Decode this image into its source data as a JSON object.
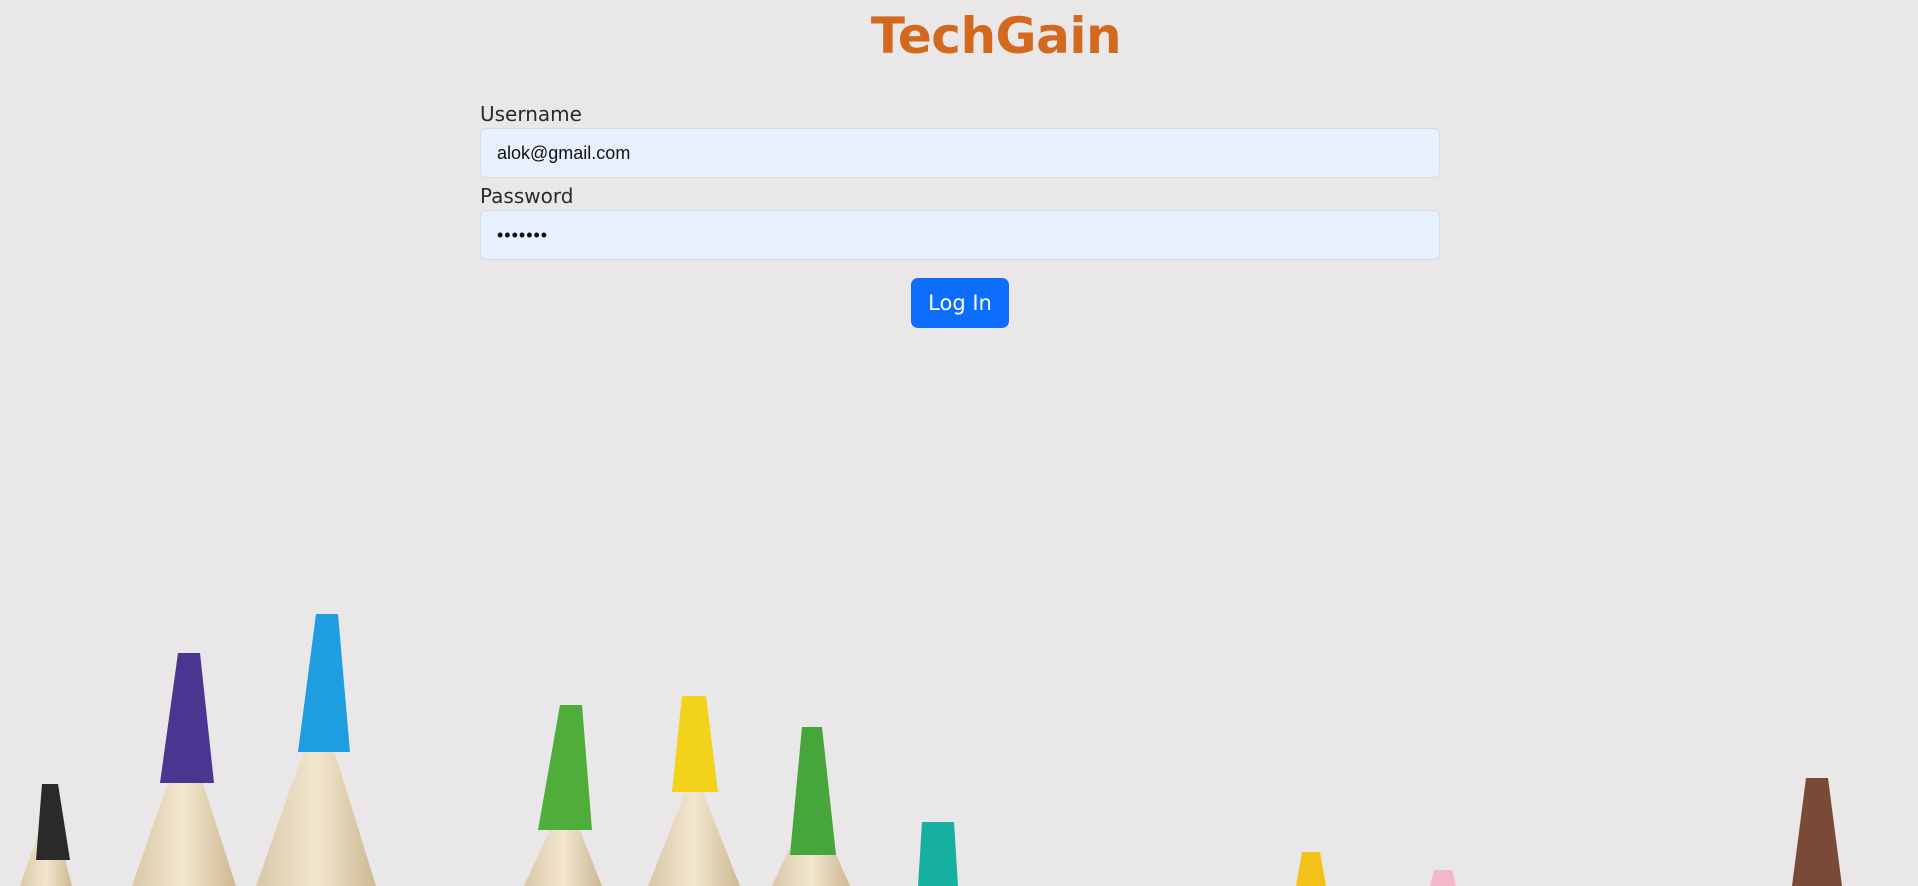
{
  "brand": {
    "title": "TechGain",
    "color": "#d2691e"
  },
  "form": {
    "username_label": "Username",
    "username_value": "alok@gmail.com",
    "password_label": "Password",
    "password_value": "1234567",
    "submit_label": "Log In",
    "accent_color": "#0d6efd",
    "input_background": "#e8f0fe"
  },
  "background": {
    "image": "colored-pencil-tips",
    "pencil_colors": [
      "#2a2a2a",
      "#4a3590",
      "#1e9ee0",
      "#4fae3a",
      "#f2d21a",
      "#46a63a",
      "#16b0a0",
      "#f3c21a",
      "#f2b8c8",
      "#7b4a36"
    ]
  }
}
